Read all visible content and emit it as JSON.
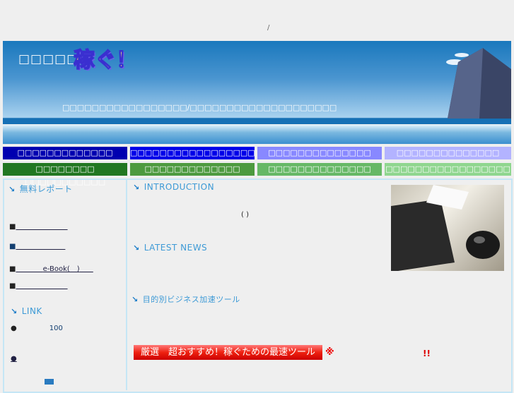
{
  "top_text": "/",
  "header": {
    "site_title": "□□□□□",
    "logo": "稼ぐ！",
    "tagline": "□□□□□□□□□□□□□□□□□/□□□□□□□□□□□□□□□□□□□□"
  },
  "nav": {
    "row1": [
      {
        "label": "□□□□□□□□□□□□□",
        "color": "#0000b0"
      },
      {
        "label": "□□□□□□□□□□□□□□□□□",
        "color": "#0000e8"
      },
      {
        "label": "□□□□□□□□□□□□□□",
        "color": "#8888ff"
      },
      {
        "label": "□□□□□□□□□□□□□□",
        "color": "#b3b3ff"
      }
    ],
    "row2": [
      {
        "label": "□□□□□□□□ □□□□□□□□□□□",
        "color": "#227722"
      },
      {
        "label": "□□□□□□□□□□□□□",
        "color": "#4d9a3f"
      },
      {
        "label": "□□□□□□□□□□□□□□",
        "color": "#66b866"
      },
      {
        "label": "□□□□□□□□□□□□□□□□□",
        "color": "#8fd68f"
      }
    ]
  },
  "sidebar": {
    "report_heading": "無料レポート",
    "links": [
      "■",
      "■",
      "■",
      "■"
    ],
    "ebook_text": "e-Book(　)",
    "link_heading": "LINK",
    "link_items": [
      "●",
      "●"
    ],
    "count": "100"
  },
  "main": {
    "intro_heading": "INTRODUCTION",
    "intro_text": "( )",
    "news_heading": "LATEST NEWS",
    "tools_heading": "目的別ビジネス加速ツール",
    "promo_banner": "厳選　超おすすめ！稼ぐための最速ツール",
    "note_mark": "※",
    "exclaim": "!!"
  }
}
